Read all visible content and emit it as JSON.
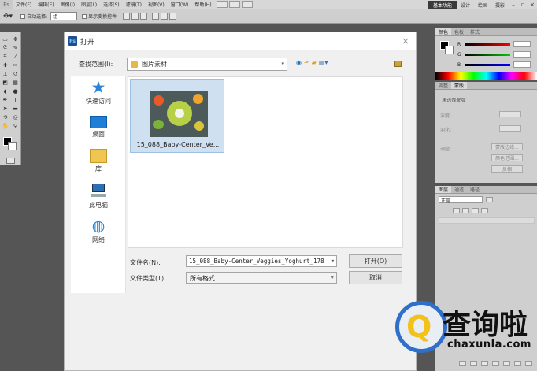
{
  "menubar": {
    "logo": "Ps",
    "items": [
      "文件(F)",
      "编辑(E)",
      "图像(I)",
      "图层(L)",
      "选择(S)",
      "滤镜(T)",
      "视图(V)",
      "窗口(W)",
      "帮助(H)"
    ],
    "workspace_label": "基本功能",
    "links": [
      "设计",
      "绘画",
      "摄影"
    ]
  },
  "optbar": {
    "auto_select_label": "自动选择:",
    "auto_select_value": "组",
    "show_transform_label": "显示变换控件"
  },
  "right_panels": {
    "color_tabs": [
      "颜色",
      "色板",
      "样式"
    ],
    "color_letters": [
      "R",
      "G",
      "B"
    ],
    "adjust_tabs": [
      "调整",
      "蒙版"
    ],
    "adjust_title": "未选择蒙版",
    "adjust_fields": [
      "浓度:",
      "羽化:",
      "调整:"
    ],
    "adjust_buttons": [
      "蒙版边缘...",
      "颜色范围...",
      "反相"
    ],
    "layers_tabs": [
      "图层",
      "通道",
      "路径"
    ],
    "blend_mode": "正常"
  },
  "dialog": {
    "icon": "Ps",
    "title": "打开",
    "look_in_label": "查找范围(I):",
    "look_in_value": "图片素材",
    "places": [
      "快速访问",
      "桌面",
      "库",
      "此电脑",
      "网络"
    ],
    "files": [
      {
        "name": "15_088_Baby-Center_Ve..."
      }
    ],
    "file_name_label": "文件名(N):",
    "file_name_value": "15_088_Baby-Center_Veggies_Yoghurt_178",
    "file_type_label": "文件类型(T):",
    "file_type_value": "所有格式",
    "open_button": "打开(O)",
    "cancel_button": "取消"
  },
  "watermark": {
    "main": "查询啦",
    "sub": "chaxunla.com"
  }
}
